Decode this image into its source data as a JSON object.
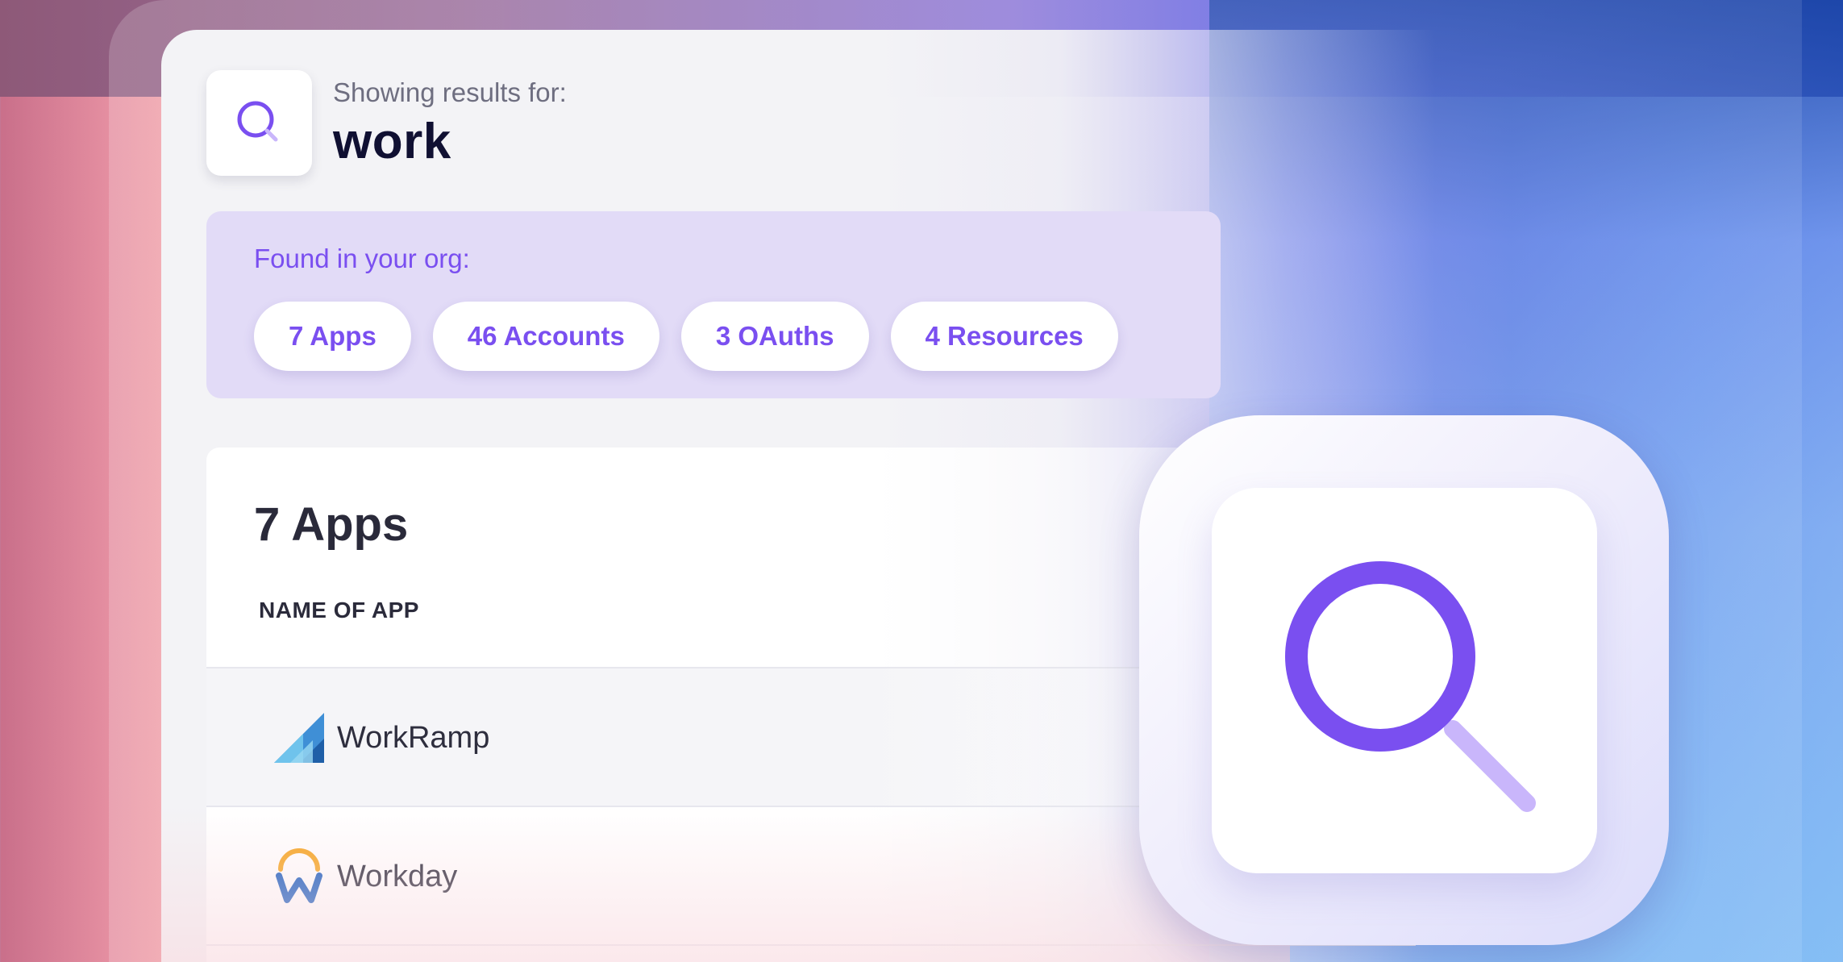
{
  "search": {
    "showing_label": "Showing results for:",
    "query": "work",
    "icon": "search-icon"
  },
  "found": {
    "label": "Found in your org:",
    "chips": [
      {
        "label": "7 Apps"
      },
      {
        "label": "46 Accounts"
      },
      {
        "label": "3 OAuths"
      },
      {
        "label": "4 Resources"
      }
    ]
  },
  "results": {
    "title": "7 Apps",
    "column_header": "NAME OF APP",
    "rows": [
      {
        "name": "WorkRamp",
        "icon": "workramp-logo-icon"
      },
      {
        "name": "Workday",
        "icon": "workday-logo-icon"
      }
    ]
  },
  "app_icon": {
    "icon": "magnifier-app-icon"
  },
  "colors": {
    "accent": "#7a4ff0",
    "accent_light": "#c9b6fb",
    "panel_tint": "#e2dbf7",
    "text_dark": "#101032"
  }
}
